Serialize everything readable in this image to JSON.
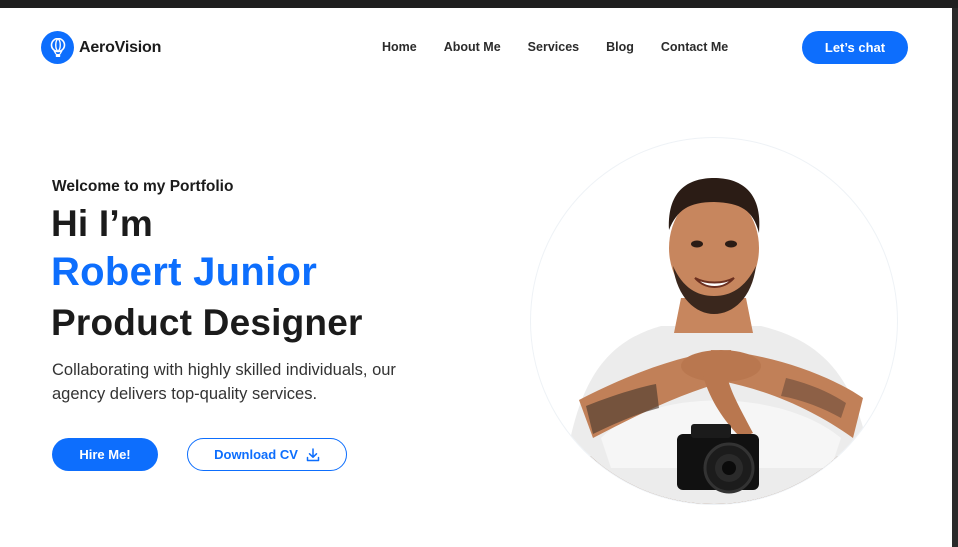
{
  "brand": {
    "name": "AeroVision",
    "logo_icon": "hot-air-balloon-icon",
    "accent": "#0d6efd"
  },
  "nav": {
    "items": [
      "Home",
      "About Me",
      "Services",
      "Blog",
      "Contact Me"
    ]
  },
  "header": {
    "cta_label": "Let’s chat"
  },
  "hero": {
    "welcome": "Welcome to my Portfolio",
    "greeting": "Hi I’m",
    "name": "Robert Junior",
    "role": "Product Designer",
    "description": "Collaborating with highly skilled individuals, our agency delivers top-quality services.",
    "hire_label": "Hire Me!",
    "download_label": "Download CV",
    "download_icon": "download-icon"
  }
}
